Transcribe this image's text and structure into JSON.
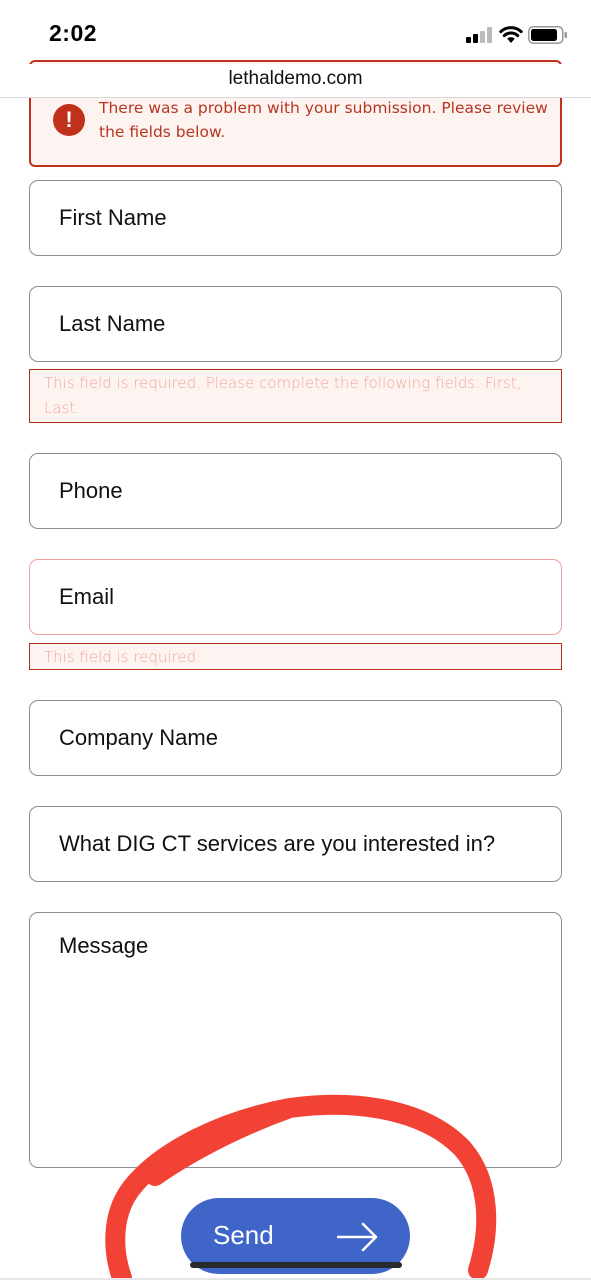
{
  "status_bar": {
    "time": "2:02"
  },
  "browser": {
    "url": "lethaldemo.com"
  },
  "form": {
    "error_banner": {
      "icon": "!",
      "message": "There was a problem with your submission. Please review the fields below."
    },
    "fields": {
      "first_name": "First Name",
      "last_name": "Last Name",
      "phone": "Phone",
      "email": "Email",
      "company": "Company Name",
      "services": "What DIG CT services are you interested in?",
      "message": "Message"
    },
    "validation": {
      "name": "This field is required. Please complete the following fields: First, Last.",
      "email": "This field is required."
    },
    "send_label": "Send"
  },
  "colors": {
    "error": "#c0311b",
    "send_button": "#3f65c8",
    "annotation_circle": "#f24236"
  },
  "icons": [
    "signal-icon",
    "wifi-icon",
    "battery-icon",
    "error-icon",
    "arrow-right-icon"
  ]
}
